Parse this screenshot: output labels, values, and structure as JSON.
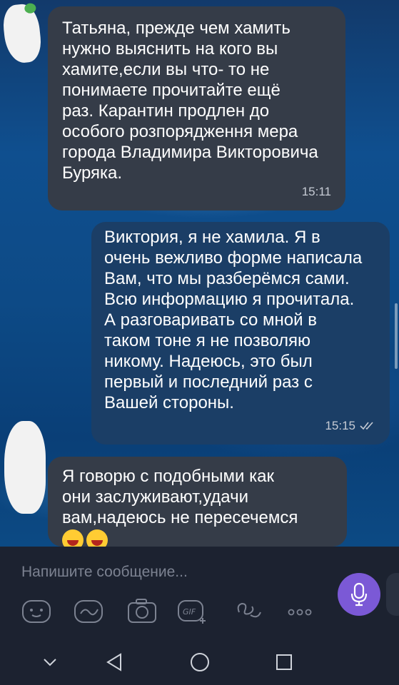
{
  "messages": [
    {
      "direction": "incoming",
      "text": "Татьяна, прежде чем хамить\nнужно выяснить на кого вы\nхамите,если вы что- то не\nпонимаете прочитайте ещё\nраз. Карантин продлен до\nособого розпорядження мера\nгорода Владимира Викторовича\nБуряка.",
      "time": "15:11"
    },
    {
      "direction": "outgoing",
      "text": "Виктория, я не хамила. Я в\nочень вежливо форме написала\nВам, что мы разберёмся сами.\nВсю информацию я прочитала.\nА разговаривать со мной в\nтаком тоне я не позволяю\nникому. Надеюсь, это был\nпервый и последний раз с\nВашей стороны.",
      "time": "15:15",
      "status": "read-double-check"
    },
    {
      "direction": "incoming",
      "text": "Я говорю с подобными как\nони заслуживают,удачи\nвам,надеюсь не пересечемся",
      "emojis": [
        "laughing-face-emoji",
        "winking-tongue-emoji"
      ]
    }
  ],
  "composer": {
    "placeholder": "Напишите сообщение...",
    "tools": [
      "sticker-icon",
      "doodle-icon",
      "camera-icon",
      "gif-icon",
      "more-stickers-icon",
      "more-icon"
    ]
  },
  "colors": {
    "incoming_bubble": "#353c48",
    "outgoing_bubble": "#1b3e66",
    "mic_button": "#7b59d6"
  },
  "navbar": [
    "chevron-down-icon",
    "back-icon",
    "home-icon",
    "recents-icon"
  ]
}
